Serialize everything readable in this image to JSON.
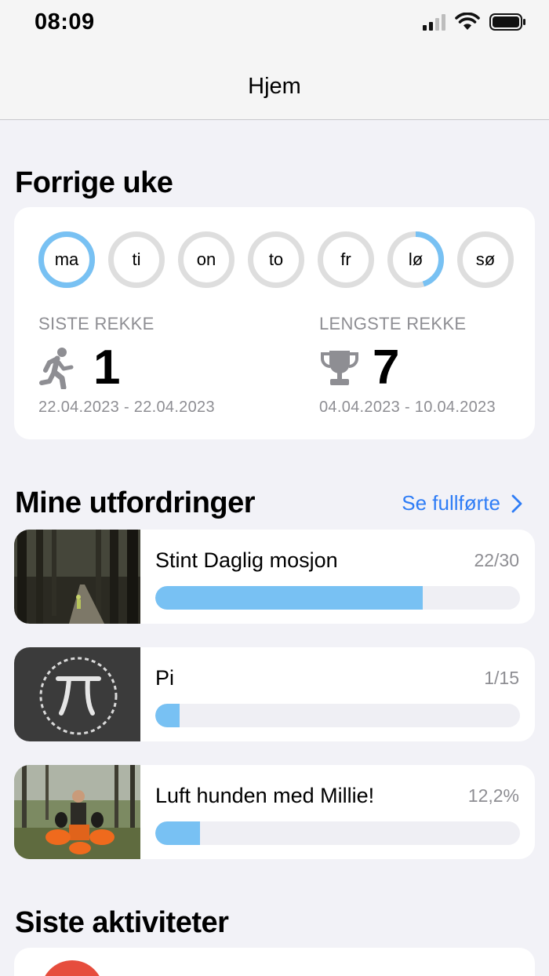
{
  "status_bar": {
    "time": "08:09"
  },
  "nav": {
    "title": "Hjem"
  },
  "last_week": {
    "title": "Forrige uke",
    "days": [
      {
        "label": "ma",
        "progress": 1.0
      },
      {
        "label": "ti",
        "progress": 0
      },
      {
        "label": "on",
        "progress": 0
      },
      {
        "label": "to",
        "progress": 0
      },
      {
        "label": "fr",
        "progress": 0
      },
      {
        "label": "lø",
        "progress": 0.45
      },
      {
        "label": "sø",
        "progress": 0
      }
    ],
    "current_streak": {
      "heading": "SISTE REKKE",
      "value": "1",
      "dates": "22.04.2023 - 22.04.2023",
      "icon": "running-person-icon"
    },
    "longest_streak": {
      "heading": "LENGSTE REKKE",
      "value": "7",
      "dates": "04.04.2023 - 10.04.2023",
      "icon": "trophy-icon"
    }
  },
  "challenges": {
    "title": "Mine utfordringer",
    "see_completed": "Se fullførte",
    "items": [
      {
        "name": "Stint Daglig mosjon",
        "count": "22/30",
        "progress": 0.733,
        "image": "forest-path-photo"
      },
      {
        "name": "Pi",
        "count": "1/15",
        "progress": 0.066,
        "image": "pi-chalkboard-photo"
      },
      {
        "name": "Luft hunden med Millie!",
        "count": "12,2%",
        "progress": 0.122,
        "image": "dogs-in-forest-photo"
      }
    ]
  },
  "activities": {
    "title": "Siste aktiviteter"
  },
  "colors": {
    "accent_blue": "#2f7df6",
    "ring_blue": "#78c1f3",
    "ring_gray": "#dedede",
    "progress_fill": "#78c1f3",
    "avatar_red": "#e64d3d"
  }
}
